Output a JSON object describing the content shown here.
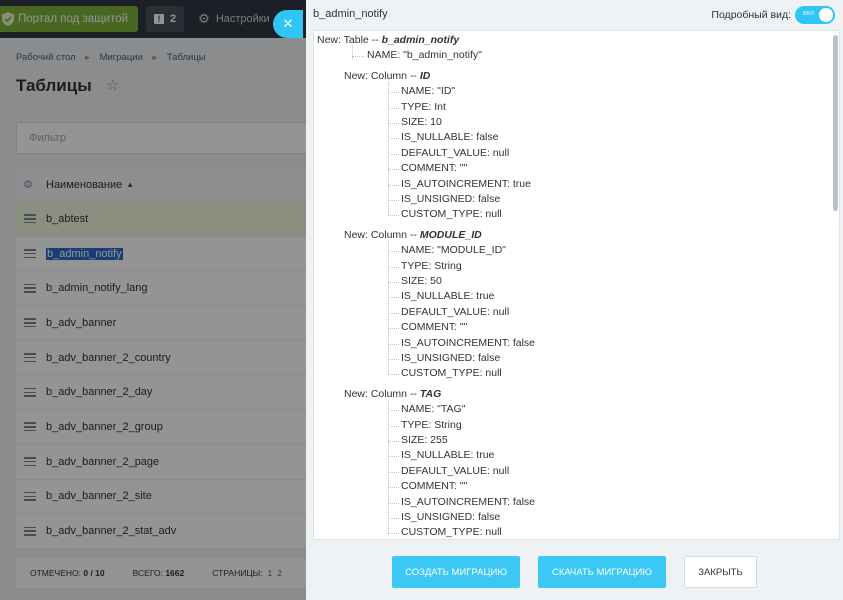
{
  "topbar": {
    "portal_label": "Портал под защитой",
    "notif_count": "2",
    "settings_label": "Настройки"
  },
  "breadcrumb": [
    "Рабочий стол",
    "Миграции",
    "Таблицы"
  ],
  "page_title": "Таблицы",
  "filter_placeholder": "Фильтр",
  "grid": {
    "column_header": "Наименование",
    "rows": [
      "b_abtest",
      "b_admin_notify",
      "b_admin_notify_lang",
      "b_adv_banner",
      "b_adv_banner_2_country",
      "b_adv_banner_2_day",
      "b_adv_banner_2_group",
      "b_adv_banner_2_page",
      "b_adv_banner_2_site",
      "b_adv_banner_2_stat_adv"
    ]
  },
  "footer": {
    "marked_label": "ОТМЕЧЕНО:",
    "marked_value": "0 / 10",
    "total_label": "ВСЕГО:",
    "total_value": "1662",
    "pages_label": "СТРАНИЦЫ:",
    "page1": "1",
    "page2": "2"
  },
  "panel": {
    "title": "b_admin_notify",
    "detail_label": "Подробный вид:",
    "toggle_label": "вкл",
    "create_button": "СОЗДАТЬ МИГРАЦИЮ",
    "download_button": "СКАЧАТЬ МИГРАЦИЮ",
    "close_button": "ЗАКРЫТЬ"
  },
  "tree": {
    "table_prefix": "New: Table -- ",
    "table_name": "b_admin_notify",
    "table_attr": "NAME: \"b_admin_notify\"",
    "column_prefix": "New: Column -- ",
    "columns": [
      {
        "name": "ID",
        "props": [
          "NAME: \"ID\"",
          "TYPE: Int",
          "SIZE: 10",
          "IS_NULLABLE: false",
          "DEFAULT_VALUE: null",
          "COMMENT: \"\"",
          "IS_AUTOINCREMENT: true",
          "IS_UNSIGNED: false",
          "CUSTOM_TYPE: null"
        ]
      },
      {
        "name": "MODULE_ID",
        "props": [
          "NAME: \"MODULE_ID\"",
          "TYPE: String",
          "SIZE: 50",
          "IS_NULLABLE: true",
          "DEFAULT_VALUE: null",
          "COMMENT: \"\"",
          "IS_AUTOINCREMENT: false",
          "IS_UNSIGNED: false",
          "CUSTOM_TYPE: null"
        ]
      },
      {
        "name": "TAG",
        "props": [
          "NAME: \"TAG\"",
          "TYPE: String",
          "SIZE: 255",
          "IS_NULLABLE: true",
          "DEFAULT_VALUE: null",
          "COMMENT: \"\"",
          "IS_AUTOINCREMENT: false",
          "IS_UNSIGNED: false",
          "CUSTOM_TYPE: null"
        ]
      }
    ]
  },
  "colors": {
    "accent": "#2fc6f6",
    "button": "#3bc8f5",
    "portal_green": "#7fb238",
    "selection": "#2a6cc8"
  }
}
